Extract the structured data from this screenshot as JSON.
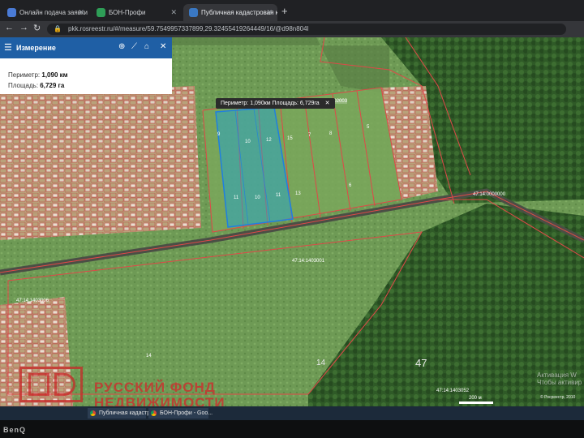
{
  "browser": {
    "tabs": [
      {
        "label": "Онлайн подача заявки на кадастр",
        "active": false,
        "favicon_color": "#4a7bd6"
      },
      {
        "label": "БОН-Профи",
        "active": false,
        "favicon_color": "#2e9e57"
      },
      {
        "label": "Публичная кадастровая карта",
        "active": true,
        "favicon_color": "#3a78c3"
      }
    ],
    "url": "pkk.rosreestr.ru/#/measure/59.75499573378​99,29.32455419264449/16/@d98n804l"
  },
  "panel": {
    "title": "Измерение",
    "perimeter_label": "Периметр:",
    "perimeter_value": "1,090 км",
    "area_label": "Площадь:",
    "area_value": "6,729 га"
  },
  "map": {
    "tooltip": "Периметр: 1,090км Площадь: 6,729га",
    "cadastral_labels": [
      "47:14:1402003",
      "47:14:1403001",
      "47:14:1403006",
      "47:14:0000000",
      "47:14:1403052"
    ],
    "plot_numbers": [
      "9",
      "10",
      "10",
      "11",
      "12",
      "15",
      "7",
      "8",
      "6",
      "5",
      "11",
      "13",
      "14",
      "47",
      "14"
    ],
    "scale_label": "200 м",
    "copyright": "© Росреестр, 2010",
    "activation_line1": "Активация W",
    "activation_line2": "Чтобы активир"
  },
  "watermark": {
    "line1": "РУССКИЙ ФОНД",
    "line2": "НЕДВИЖИМОСТИ"
  },
  "taskbar": {
    "items": [
      "Публичная кадастр...",
      "БОН-Профи - Goo..."
    ]
  },
  "monitor_brand": "BenQ",
  "colors": {
    "panel_header": "#1f5fa5",
    "measure_fill": "#1aa3d9",
    "boundary": "#e04848"
  }
}
